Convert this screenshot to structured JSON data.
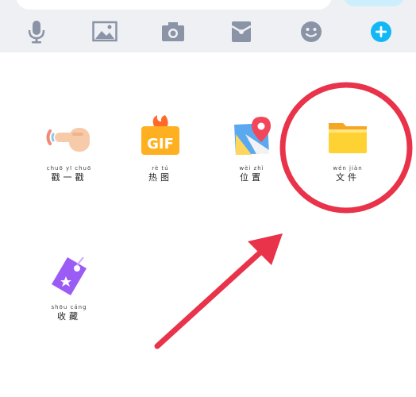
{
  "toolbar": {
    "items": [
      {
        "icon": "microphone-icon"
      },
      {
        "icon": "image-icon"
      },
      {
        "icon": "camera-icon"
      },
      {
        "icon": "red-packet-icon"
      },
      {
        "icon": "emoji-icon"
      },
      {
        "icon": "plus-icon"
      }
    ]
  },
  "panel": {
    "apps": [
      {
        "icon": "poke-hand-icon",
        "pinyin": "chuō yī chuō",
        "label": "戳一戳"
      },
      {
        "icon": "gif-icon",
        "gif_text": "GIF",
        "pinyin": "rè tú",
        "label": "热图"
      },
      {
        "icon": "location-map-icon",
        "pinyin": "wèi zhì",
        "label": "位置"
      },
      {
        "icon": "folder-icon",
        "pinyin": "wén jiàn",
        "label": "文件"
      },
      {
        "icon": "favorites-ticket-icon",
        "pinyin": "shōu cáng",
        "label": "收藏"
      }
    ]
  },
  "annotation": {
    "color": "#e8334a"
  }
}
